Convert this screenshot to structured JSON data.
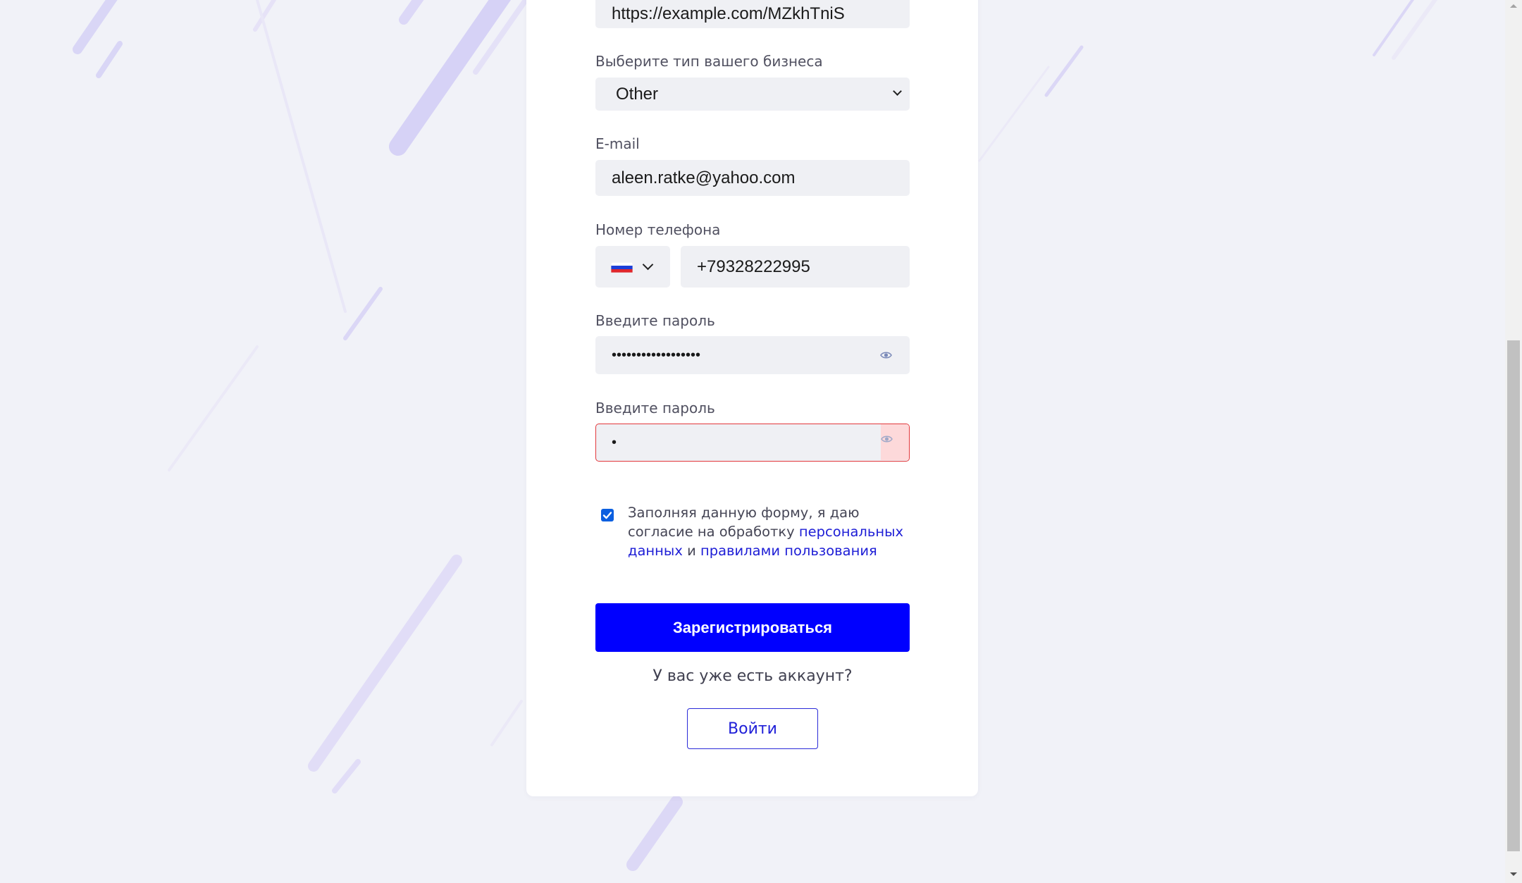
{
  "form": {
    "website_value": "https://example.com/MZkhTniS",
    "business_type_label": "Выберите тип вашего бизнеса",
    "business_type_value": "Other",
    "email_label": "E-mail",
    "email_value": "aleen.ratke@yahoo.com",
    "phone_label": "Номер телефона",
    "phone_country_flag": "ru-flag-icon",
    "phone_value": "+79328222995",
    "password_label": "Введите пароль",
    "password_value": "••••••••••••••••••",
    "password_confirm_label": "Введите пароль",
    "password_confirm_value": "•",
    "consent_checked": true,
    "consent_text_1": "Заполняя данную форму, я даю согласие на обработку ",
    "consent_link_1": "персональных данных",
    "consent_text_2": " и ",
    "consent_link_2": "правилами пользования",
    "submit_label": "Зарегистрироваться",
    "have_account_text": "У вас уже есть аккаунт?",
    "login_label": "Войти"
  },
  "colors": {
    "accent": "#0000ff",
    "link": "#1e1ed6",
    "error_border": "#e2373b",
    "error_fill": "#fde0e0",
    "page_bg": "#f1f2f8",
    "input_bg": "#eff0f4"
  }
}
